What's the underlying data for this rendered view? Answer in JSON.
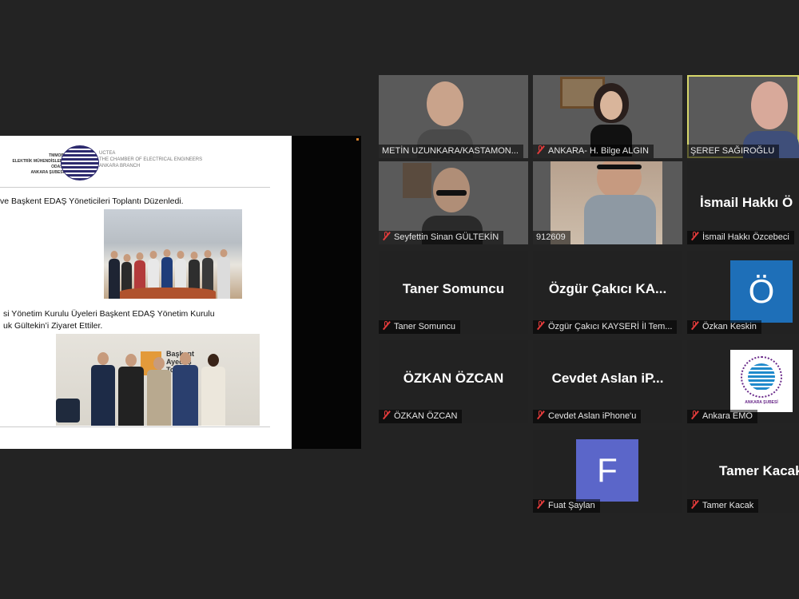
{
  "slide": {
    "logo_left_lines": [
      "TMMOB",
      "ELEKTRİK MÜHENDİSLERİ ODASI",
      "ANKARA ŞUBESİ"
    ],
    "logo_right_lines": [
      "UCTEA",
      "THE CHAMBER OF ELECTRICAL ENGINEERS",
      "ANKARA BRANCH"
    ],
    "heading1": "ve Başkent EDAŞ Yöneticileri Toplantı Düzenledi.",
    "heading2_line1": "si Yönetim Kurulu Üyeleri Başkent EDAŞ Yönetim Kurulu",
    "heading2_line2": "uk Gültekin’i Ziyaret Ettiler.",
    "sign_text": "Başkent\nAyedaş\nTop"
  },
  "participants": [
    {
      "label": "METİN UZUNKARA/KASTAMON...",
      "muted": false,
      "kind": "video"
    },
    {
      "label": "ANKARA- H. Bilge ALGIN",
      "muted": true,
      "kind": "video"
    },
    {
      "label": "ŞEREF SAĞIROĞLU",
      "muted": false,
      "kind": "video",
      "active": true
    },
    {
      "label": "Seyfettin Sinan GÜLTEKİN",
      "muted": true,
      "kind": "video"
    },
    {
      "label": "912609",
      "muted": false,
      "kind": "video"
    },
    {
      "label": "İsmail Hakkı Özcebeci",
      "muted": true,
      "kind": "name",
      "big": "İsmail Hakkı Ö"
    },
    {
      "label": "Taner Somuncu",
      "muted": true,
      "kind": "name",
      "big": "Taner Somuncu"
    },
    {
      "label": "Özgür Çakıcı KAYSERİ İl Tem...",
      "muted": true,
      "kind": "name",
      "big": "Özgür Çakıcı KA..."
    },
    {
      "label": "Özkan Keskin",
      "muted": true,
      "kind": "avatar",
      "initial": "Ö",
      "color": "#1e6fb8"
    },
    {
      "label": "ÖZKAN ÖZCAN",
      "muted": true,
      "kind": "name",
      "big": "ÖZKAN ÖZCAN"
    },
    {
      "label": "Cevdet Aslan iPhone'u",
      "muted": true,
      "kind": "name",
      "big": "Cevdet Aslan iP..."
    },
    {
      "label": "Ankara EMO",
      "muted": true,
      "kind": "logo",
      "logo_text": "ANKARA ŞUBESİ"
    },
    {
      "label": "Fuat Şaylan",
      "muted": true,
      "kind": "avatar",
      "initial": "F",
      "color": "#5b66c9"
    },
    {
      "label": "Tamer Kacak",
      "muted": true,
      "kind": "name",
      "big": "Tamer Kacak"
    }
  ]
}
